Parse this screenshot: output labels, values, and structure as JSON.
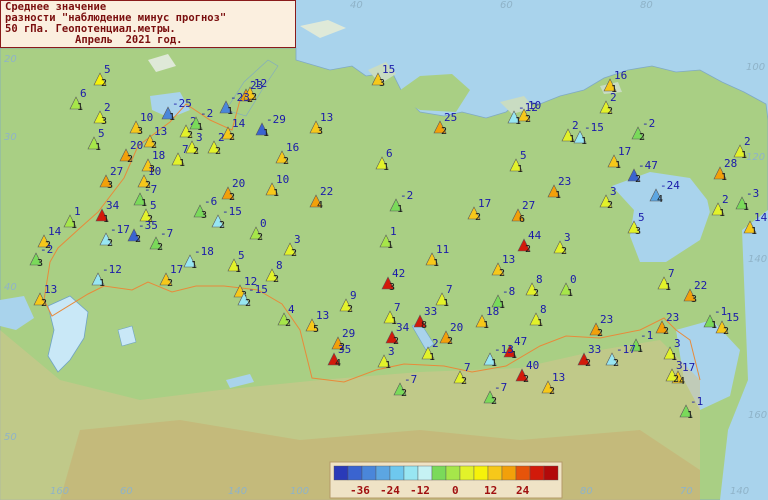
{
  "title": {
    "line1": "Среднее значение",
    "line2": "разности \"наблюдение минус прогноз\"",
    "line3": "50 гПа. Геопотенциал.метры.",
    "line4": "Апрель  2021 год."
  },
  "graticule_labels": [
    "40",
    "60",
    "80",
    "100",
    "120",
    "140",
    "160",
    "180",
    "160",
    "140",
    "20",
    "30",
    "40",
    "50",
    "60",
    "70",
    "80",
    "140",
    "120",
    "100"
  ],
  "color_scale": {
    "colors": [
      "#2a3ab8",
      "#3a64d0",
      "#4a86da",
      "#5ca6e2",
      "#6ec8ee",
      "#98e6f2",
      "#c6f2f4",
      "#7ada5a",
      "#a6e64a",
      "#e2f22a",
      "#f6f20a",
      "#f6c81a",
      "#f2a00a",
      "#e6540a",
      "#d21a0a",
      "#b20a0a"
    ],
    "labels": [
      "-36",
      "-24",
      "-12",
      "0",
      "12",
      "24"
    ]
  },
  "colors": {
    "sea": "#a9d3ec",
    "land": "#a9cf84",
    "border": "#e88a3a",
    "title_text": "#7a0e0e",
    "value_text": "#1a1aaa"
  },
  "stations": [
    {
      "v": "5",
      "n": "2",
      "c": "#f6f20a"
    },
    {
      "v": "6",
      "n": "1",
      "c": "#a6e64a"
    },
    {
      "v": "2",
      "n": "3",
      "c": "#e2f22a"
    },
    {
      "v": "10",
      "n": "3",
      "c": "#f6c81a"
    },
    {
      "v": "5",
      "n": "1",
      "c": "#a6e64a"
    },
    {
      "v": "-25",
      "n": "1",
      "c": "#4a86da"
    },
    {
      "v": "23",
      "n": "2",
      "c": "#f2a00a"
    },
    {
      "v": "12",
      "n": "2",
      "c": "#f6c81a"
    },
    {
      "v": "-23",
      "n": "1",
      "c": "#4a86da"
    },
    {
      "v": "15",
      "n": "3",
      "c": "#f6c81a"
    },
    {
      "v": "16",
      "n": "1",
      "c": "#f6c81a"
    },
    {
      "v": "2",
      "n": "2",
      "c": "#e2f22a"
    },
    {
      "v": "10",
      "n": "2",
      "c": "#f6c81a"
    },
    {
      "v": "2",
      "n": "2",
      "c": "#e2f22a"
    },
    {
      "v": "-2",
      "n": "1",
      "c": "#7ada5a"
    },
    {
      "v": "20",
      "n": "2",
      "c": "#f2a00a"
    },
    {
      "v": "13",
      "n": "2",
      "c": "#f6c81a"
    },
    {
      "v": "14",
      "n": "2",
      "c": "#f6c81a"
    },
    {
      "v": "-29",
      "n": "1",
      "c": "#3a64d0"
    },
    {
      "v": "13",
      "n": "3",
      "c": "#f6c81a"
    },
    {
      "v": "25",
      "n": "2",
      "c": "#f2a00a"
    },
    {
      "v": "-12",
      "n": "1",
      "c": "#98e6f2"
    },
    {
      "v": "-2",
      "n": "2",
      "c": "#7ada5a"
    },
    {
      "v": "2",
      "n": "1",
      "c": "#e2f22a"
    },
    {
      "v": "-15",
      "n": "1",
      "c": "#98e6f2"
    },
    {
      "v": "2",
      "n": "2",
      "c": "#e2f22a"
    },
    {
      "v": "18",
      "n": "3",
      "c": "#f6c81a"
    },
    {
      "v": "7",
      "n": "1",
      "c": "#e2f22a"
    },
    {
      "v": "3",
      "n": "2",
      "c": "#e2f22a"
    },
    {
      "v": "16",
      "n": "2",
      "c": "#f6c81a"
    },
    {
      "v": "6",
      "n": "1",
      "c": "#e2f22a"
    },
    {
      "v": "5",
      "n": "1",
      "c": "#e2f22a"
    },
    {
      "v": "17",
      "n": "1",
      "c": "#f6c81a"
    },
    {
      "v": "-47",
      "n": "2",
      "c": "#3a64d0"
    },
    {
      "v": "28",
      "n": "1",
      "c": "#f2a00a"
    },
    {
      "v": "27",
      "n": "3",
      "c": "#f2a00a"
    },
    {
      "v": "10",
      "n": "2",
      "c": "#f6c81a"
    },
    {
      "v": "10",
      "n": "1",
      "c": "#f6c81a"
    },
    {
      "v": "20",
      "n": "2",
      "c": "#f2a00a"
    },
    {
      "v": "2",
      "n": "1",
      "c": "#e2f22a"
    },
    {
      "v": "23",
      "n": "1",
      "c": "#f2a00a"
    },
    {
      "v": "3",
      "n": "2",
      "c": "#e2f22a"
    },
    {
      "v": "-24",
      "n": "4",
      "c": "#5ca6e2"
    },
    {
      "v": "-3",
      "n": "1",
      "c": "#7ada5a"
    },
    {
      "v": "2",
      "n": "1",
      "c": "#e2f22a"
    },
    {
      "v": "-7",
      "n": "1",
      "c": "#7ada5a"
    },
    {
      "v": "-6",
      "n": "3",
      "c": "#7ada5a"
    },
    {
      "v": "22",
      "n": "4",
      "c": "#f2a00a"
    },
    {
      "v": "-2",
      "n": "1",
      "c": "#7ada5a"
    },
    {
      "v": "17",
      "n": "2",
      "c": "#f6c81a"
    },
    {
      "v": "27",
      "n": "6",
      "c": "#f2a00a"
    },
    {
      "v": "5",
      "n": "3",
      "c": "#e2f22a"
    },
    {
      "v": "3",
      "n": "2",
      "c": "#e2f22a"
    },
    {
      "v": "14",
      "n": "1",
      "c": "#f6c81a"
    },
    {
      "v": "34",
      "n": "1",
      "c": "#d21a0a"
    },
    {
      "v": "1",
      "n": "1",
      "c": "#a6e64a"
    },
    {
      "v": "5",
      "n": "2",
      "c": "#e2f22a"
    },
    {
      "v": "-15",
      "n": "2",
      "c": "#98e6f2"
    },
    {
      "v": "14",
      "n": "2",
      "c": "#f6c81a"
    },
    {
      "v": "-17",
      "n": "2",
      "c": "#98e6f2"
    },
    {
      "v": "-35",
      "n": "2",
      "c": "#3a64d0"
    },
    {
      "v": "0",
      "n": "2",
      "c": "#a6e64a"
    },
    {
      "v": "-7",
      "n": "2",
      "c": "#7ada5a"
    },
    {
      "v": "1",
      "n": "1",
      "c": "#a6e64a"
    },
    {
      "v": "11",
      "n": "1",
      "c": "#f6c81a"
    },
    {
      "v": "44",
      "n": "2",
      "c": "#d21a0a"
    },
    {
      "v": "-18",
      "n": "1",
      "c": "#98e6f2"
    },
    {
      "v": "3",
      "n": "2",
      "c": "#e2f22a"
    },
    {
      "v": "-2",
      "n": "3",
      "c": "#7ada5a"
    },
    {
      "v": "17",
      "n": "2",
      "c": "#f6c81a"
    },
    {
      "v": "13",
      "n": "2",
      "c": "#f6c81a"
    },
    {
      "v": "5",
      "n": "1",
      "c": "#e2f22a"
    },
    {
      "v": "8",
      "n": "2",
      "c": "#e2f22a"
    },
    {
      "v": "42",
      "n": "3",
      "c": "#d21a0a"
    },
    {
      "v": "12",
      "n": "3",
      "c": "#f6c81a"
    },
    {
      "v": "8",
      "n": "2",
      "c": "#e2f22a"
    },
    {
      "v": "0",
      "n": "1",
      "c": "#a6e64a"
    },
    {
      "v": "7",
      "n": "1",
      "c": "#e2f22a"
    },
    {
      "v": "22",
      "n": "3",
      "c": "#f2a00a"
    },
    {
      "v": "-12",
      "n": "1",
      "c": "#98e6f2"
    },
    {
      "v": "-15",
      "n": "2",
      "c": "#98e6f2"
    },
    {
      "v": "9",
      "n": "2",
      "c": "#e2f22a"
    },
    {
      "v": "7",
      "n": "1",
      "c": "#e2f22a"
    },
    {
      "v": "-8",
      "n": "1",
      "c": "#7ada5a"
    },
    {
      "v": "13",
      "n": "2",
      "c": "#f6c81a"
    },
    {
      "v": "4",
      "n": "2",
      "c": "#a6e64a"
    },
    {
      "v": "13",
      "n": "5",
      "c": "#f6c81a"
    },
    {
      "v": "7",
      "n": "1",
      "c": "#e2f22a"
    },
    {
      "v": "33",
      "n": "8",
      "c": "#d21a0a"
    },
    {
      "v": "18",
      "n": "1",
      "c": "#f6c81a"
    },
    {
      "v": "8",
      "n": "1",
      "c": "#e2f22a"
    },
    {
      "v": "23",
      "n": "2",
      "c": "#f2a00a"
    },
    {
      "v": "23",
      "n": "2",
      "c": "#f2a00a"
    },
    {
      "v": "-1",
      "n": "1",
      "c": "#7ada5a"
    },
    {
      "v": "15",
      "n": "2",
      "c": "#f6c81a"
    },
    {
      "v": "29",
      "n": "2",
      "c": "#f2a00a"
    },
    {
      "v": "34",
      "n": "2",
      "c": "#d21a0a"
    },
    {
      "v": "20",
      "n": "2",
      "c": "#f2a00a"
    },
    {
      "v": "47",
      "n": "1",
      "c": "#d21a0a"
    },
    {
      "v": "33",
      "n": "2",
      "c": "#d21a0a"
    },
    {
      "v": "-1",
      "n": "1",
      "c": "#7ada5a"
    },
    {
      "v": "-17",
      "n": "2",
      "c": "#98e6f2"
    },
    {
      "v": "35",
      "n": "4",
      "c": "#d21a0a"
    },
    {
      "v": "3",
      "n": "1",
      "c": "#e2f22a"
    },
    {
      "v": "2",
      "n": "1",
      "c": "#e2f22a"
    },
    {
      "v": "-13",
      "n": "1",
      "c": "#98e6f2"
    },
    {
      "v": "40",
      "n": "2",
      "c": "#d21a0a"
    },
    {
      "v": "3",
      "n": "1",
      "c": "#e2f22a"
    },
    {
      "v": "17",
      "n": "4",
      "c": "#f6c81a"
    },
    {
      "v": "7",
      "n": "2",
      "c": "#e2f22a"
    },
    {
      "v": "-7",
      "n": "2",
      "c": "#7ada5a"
    },
    {
      "v": "13",
      "n": "2",
      "c": "#f6c81a"
    },
    {
      "v": "3",
      "n": "2",
      "c": "#e2f22a"
    },
    {
      "v": "-7",
      "n": "2",
      "c": "#7ada5a"
    },
    {
      "v": "-1",
      "n": "1",
      "c": "#7ada5a"
    }
  ]
}
